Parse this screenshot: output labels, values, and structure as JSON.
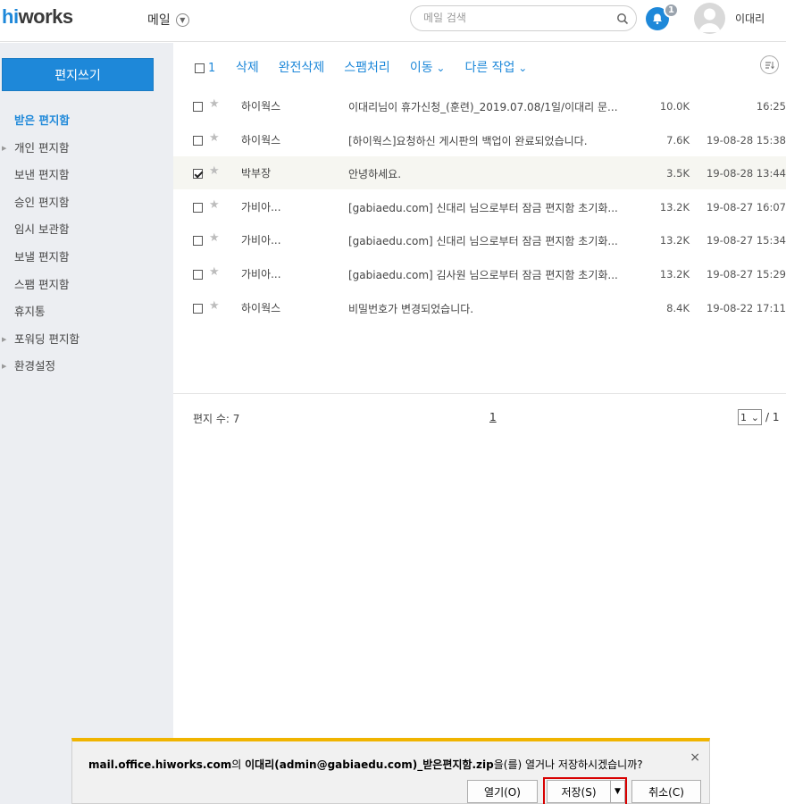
{
  "header": {
    "logo_prefix": "hi",
    "logo_rest": "works",
    "app_title": "메일",
    "search_placeholder": "메일 검색",
    "notification_count": "1",
    "user_name": "이대리"
  },
  "sidebar": {
    "compose_label": "편지쓰기",
    "items": [
      {
        "label": "받은 편지함",
        "active": true,
        "caret": false
      },
      {
        "label": "개인 편지함",
        "active": false,
        "caret": true
      },
      {
        "label": "보낸 편지함",
        "active": false,
        "caret": false
      },
      {
        "label": "승인 편지함",
        "active": false,
        "caret": false
      },
      {
        "label": "임시 보관함",
        "active": false,
        "caret": false
      },
      {
        "label": "보낼 편지함",
        "active": false,
        "caret": false
      },
      {
        "label": "스팸 편지함",
        "active": false,
        "caret": false
      },
      {
        "label": "휴지통",
        "active": false,
        "caret": false
      },
      {
        "label": "포워딩 편지함",
        "active": false,
        "caret": true
      },
      {
        "label": "환경설정",
        "active": false,
        "caret": true
      }
    ]
  },
  "toolbar": {
    "selected_count": "1",
    "delete_label": "삭제",
    "perm_delete_label": "완전삭제",
    "spam_label": "스팸처리",
    "move_label": "이동",
    "more_label": "다른 작업"
  },
  "mails": [
    {
      "checked": false,
      "sender": "하이웍스",
      "subject": "이대리님이 휴가신청_(훈련)_2019.07.08/1일/이대리 문...",
      "size": "10.0K",
      "date": "16:25"
    },
    {
      "checked": false,
      "sender": "하이웍스",
      "subject": "[하이웍스]요청하신 게시판의 백업이 완료되었습니다.",
      "size": "7.6K",
      "date": "19-08-28 15:38"
    },
    {
      "checked": true,
      "sender": "박부장",
      "subject": "안녕하세요.",
      "size": "3.5K",
      "date": "19-08-28 13:44"
    },
    {
      "checked": false,
      "sender": "가비아...",
      "subject": "[gabiaedu.com] 신대리 님으로부터 잠금 편지함 초기화...",
      "size": "13.2K",
      "date": "19-08-27 16:07"
    },
    {
      "checked": false,
      "sender": "가비아...",
      "subject": "[gabiaedu.com] 신대리 님으로부터 잠금 편지함 초기화...",
      "size": "13.2K",
      "date": "19-08-27 15:34"
    },
    {
      "checked": false,
      "sender": "가비아...",
      "subject": "[gabiaedu.com] 김사원 님으로부터 잠금 편지함 초기화...",
      "size": "13.2K",
      "date": "19-08-27 15:29"
    },
    {
      "checked": false,
      "sender": "하이웍스",
      "subject": "비밀번호가 변경되었습니다.",
      "size": "8.4K",
      "date": "19-08-22 17:11"
    }
  ],
  "footer": {
    "mail_count": "편지 수: 7",
    "current_page": "1",
    "page_select_value": "1",
    "page_total": "/ 1"
  },
  "download_bar": {
    "site": "mail.office.hiworks.com",
    "msg_mid": "의 ",
    "filename": "이대리(admin@gabiaedu.com)_받은편지함.zip",
    "msg_end": "을(를) 열거나 저장하시겠습니까?",
    "open_label": "열기(O)",
    "save_label": "저장(S)",
    "cancel_label": "취소(C)"
  },
  "colors": {
    "accent": "#1e88d9",
    "download_bar_border": "#f0b400",
    "save_highlight": "#d80000"
  }
}
